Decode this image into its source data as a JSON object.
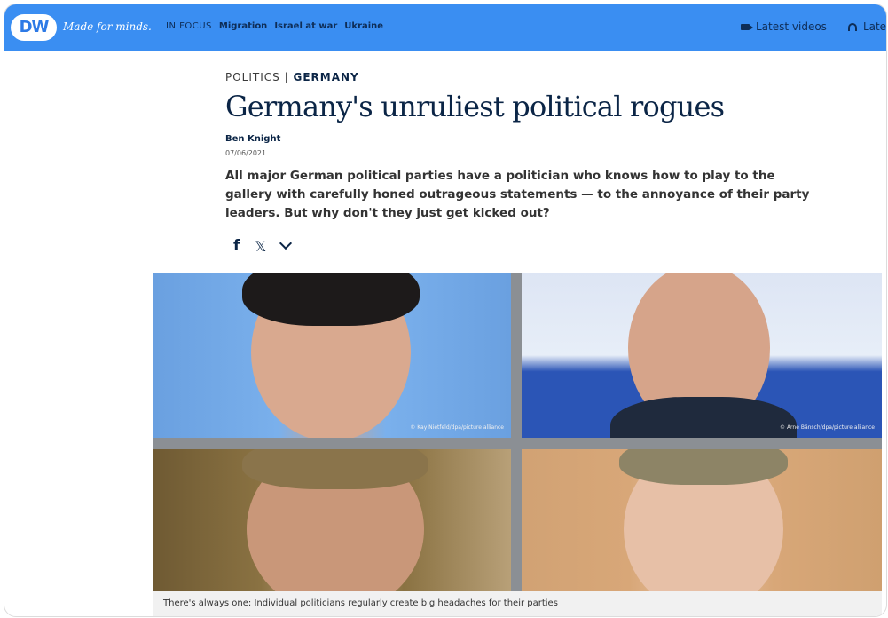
{
  "header": {
    "logo_text": "DW",
    "tagline": "Made for minds.",
    "nav_focus": "IN FOCUS",
    "nav_items": [
      "Migration",
      "Israel at war",
      "Ukraine"
    ],
    "latest_videos": "Latest videos",
    "latest_audio": "Late"
  },
  "article": {
    "kicker_section": "POLITICS",
    "kicker_sep": "|",
    "kicker_topic": "GERMANY",
    "title": "Germany's unruliest political rogues",
    "author": "Ben Knight",
    "date": "07/06/2021",
    "lead": "All major German political parties have a politician who knows how to play to the gallery with carefully honed outrageous statements — to the annoyance of their party leaders. But why don't they just get kicked out?",
    "share": {
      "facebook": "f",
      "x": "𝕏"
    }
  },
  "image": {
    "credits": [
      "© Kay Nietfeld/dpa/picture alliance",
      "© Arne Bänsch/dpa/picture alliance"
    ],
    "caption": "There's always one: Individual politicians regularly create big headaches for their parties"
  },
  "colors": {
    "brand_blue": "#3a8ef2",
    "navy": "#0b2546"
  },
  "icons": [
    "dw-logo",
    "video-camera-icon",
    "headphones-icon",
    "facebook-icon",
    "x-icon",
    "chevron-down-icon"
  ]
}
